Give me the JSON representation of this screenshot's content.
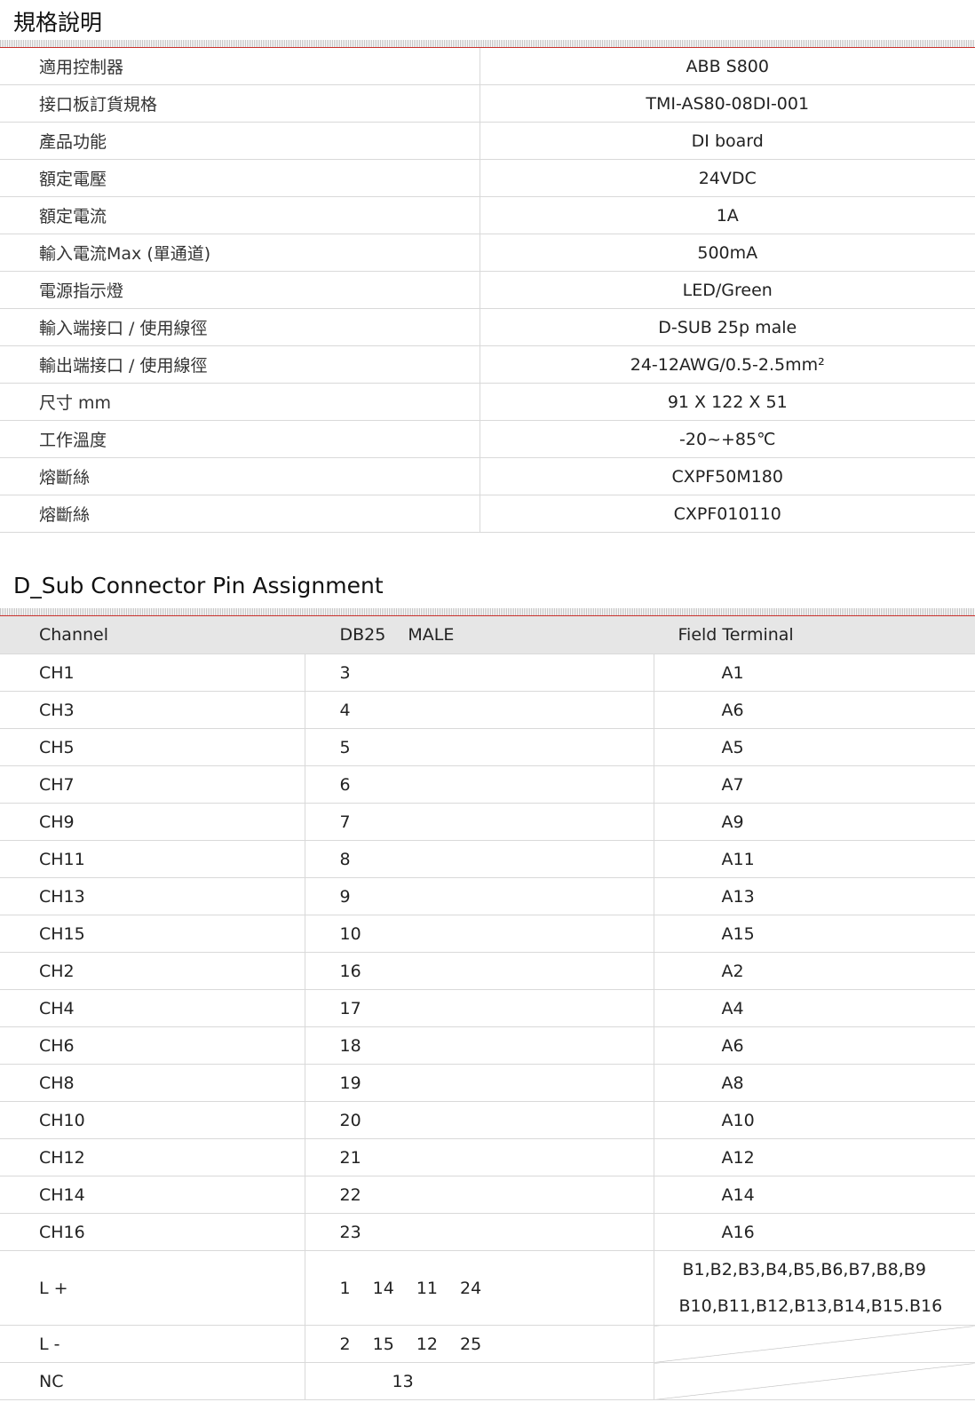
{
  "spec": {
    "title": "規格說明",
    "rows": [
      {
        "label": "適用控制器",
        "value": "ABB S800"
      },
      {
        "label": "接口板訂貨規格",
        "value": "TMI-AS80-08DI-001"
      },
      {
        "label": "產品功能",
        "value": "DI board"
      },
      {
        "label": "額定電壓",
        "value": "24VDC"
      },
      {
        "label": "額定電流",
        "value": "1A"
      },
      {
        "label": "輸入電流Max (單通道)",
        "value": "500mA"
      },
      {
        "label": "電源指示燈",
        "value": "LED/Green"
      },
      {
        "label": "輸入端接口 / 使用線徑",
        "value": "D-SUB 25p male"
      },
      {
        "label": "輸出端接口 / 使用線徑",
        "value": "24-12AWG/0.5-2.5mm²"
      },
      {
        "label": "尺寸 mm",
        "value": "91 X 122 X 51"
      },
      {
        "label": "工作溫度",
        "value": "-20~+85℃"
      },
      {
        "label": "熔斷絲",
        "value": "CXPF50M180"
      },
      {
        "label": "熔斷絲",
        "value": "CXPF010110"
      }
    ]
  },
  "pin": {
    "title": "D_Sub Connector Pin Assignment",
    "headers": {
      "channel": "Channel",
      "db25": "DB25  MALE",
      "field": "Field  Terminal"
    },
    "rows": [
      {
        "channel": "CH1",
        "db25": "3",
        "field": "A1"
      },
      {
        "channel": "CH3",
        "db25": "4",
        "field": "A6"
      },
      {
        "channel": "CH5",
        "db25": "5",
        "field": "A5"
      },
      {
        "channel": "CH7",
        "db25": "6",
        "field": "A7"
      },
      {
        "channel": "CH9",
        "db25": "7",
        "field": "A9"
      },
      {
        "channel": "CH11",
        "db25": "8",
        "field": "A11"
      },
      {
        "channel": "CH13",
        "db25": "9",
        "field": "A13"
      },
      {
        "channel": "CH15",
        "db25": "10",
        "field": "A15"
      },
      {
        "channel": "CH2",
        "db25": "16",
        "field": "A2"
      },
      {
        "channel": "CH4",
        "db25": "17",
        "field": "A4"
      },
      {
        "channel": "CH6",
        "db25": "18",
        "field": "A6"
      },
      {
        "channel": "CH8",
        "db25": "19",
        "field": "A8"
      },
      {
        "channel": "CH10",
        "db25": "20",
        "field": "A10"
      },
      {
        "channel": "CH12",
        "db25": "21",
        "field": "A12"
      },
      {
        "channel": "CH14",
        "db25": "22",
        "field": "A14"
      },
      {
        "channel": "CH16",
        "db25": "23",
        "field": "A16"
      }
    ],
    "lplus": {
      "channel": "L +",
      "db25": "1  14  11  24",
      "field_line1": "B1,B2,B3,B4,B5,B6,B7,B8,B9",
      "field_line2": "B10,B11,B12,B13,B14,B15.B16"
    },
    "lminus": {
      "channel": "L -",
      "db25": "2  15  12  25"
    },
    "nc": {
      "channel": "NC",
      "db25": "13"
    }
  }
}
